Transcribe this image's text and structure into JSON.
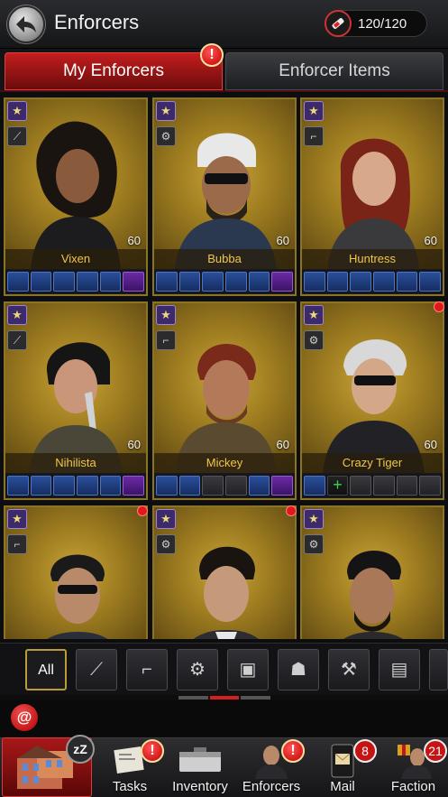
{
  "header": {
    "title": "Enforcers",
    "energy": "120/120"
  },
  "tabs": [
    {
      "label": "My Enforcers",
      "active": true,
      "alert": "!"
    },
    {
      "label": "Enforcer Items",
      "active": false
    }
  ],
  "enforcers": [
    {
      "name": "Vixen",
      "level": "60"
    },
    {
      "name": "Bubba",
      "level": "60"
    },
    {
      "name": "Huntress",
      "level": "60"
    },
    {
      "name": "Nihilista",
      "level": "60"
    },
    {
      "name": "Mickey",
      "level": "60"
    },
    {
      "name": "Crazy Tiger",
      "level": "60"
    }
  ],
  "filters": {
    "all_label": "All"
  },
  "chat": {
    "button": "@"
  },
  "nav": {
    "hq_badge": "zZ",
    "tasks": {
      "label": "Tasks",
      "alert": "!"
    },
    "inventory": {
      "label": "Inventory"
    },
    "enforcers": {
      "label": "Enforcers",
      "alert": "!"
    },
    "mail": {
      "label": "Mail",
      "count": "8"
    },
    "faction": {
      "label": "Faction",
      "count": "21"
    }
  },
  "colors": {
    "accent": "#c41d1d",
    "gold": "#f0c64a",
    "gear_blue": "#2a4f9a",
    "gear_purple": "#6b2aa5"
  }
}
